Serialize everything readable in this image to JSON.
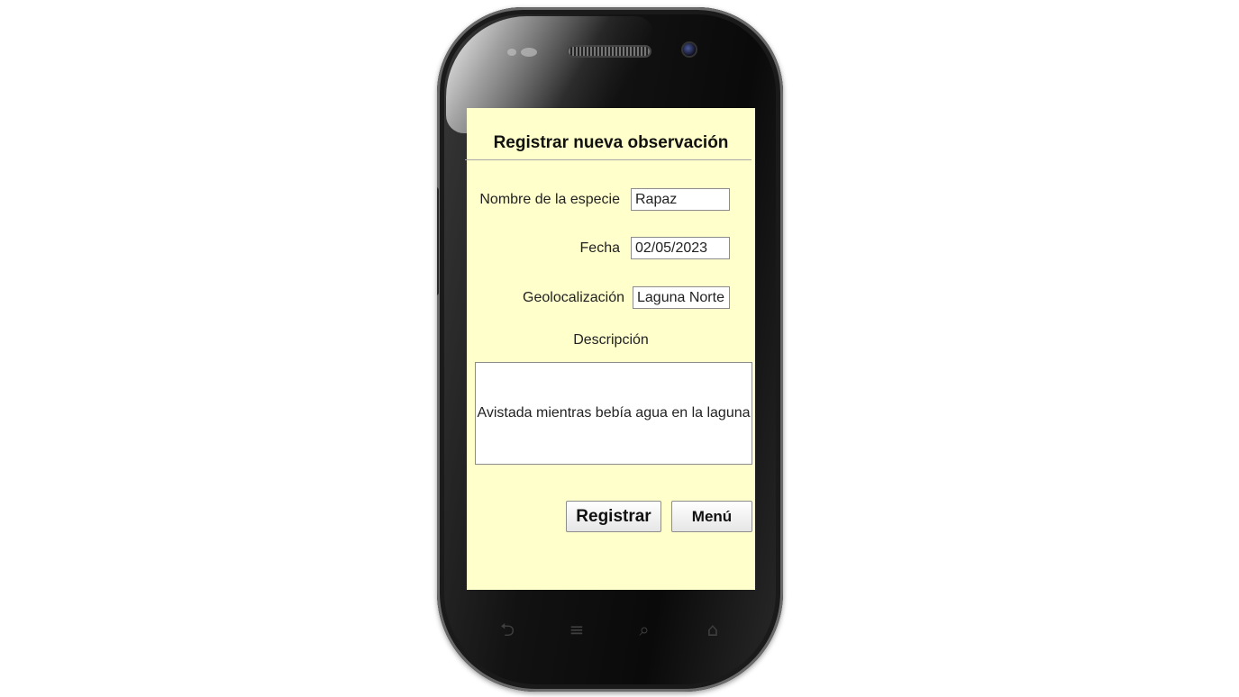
{
  "form": {
    "title": "Registrar nueva observación",
    "species_label": "Nombre de la especie",
    "species_value": "Rapaz",
    "date_label": "Fecha",
    "date_value": "02/05/2023",
    "geo_label": "Geolocalización",
    "geo_value": "Laguna Norte",
    "description_label": "Descripción",
    "description_value": "Avistada mientras bebía agua en la laguna"
  },
  "buttons": {
    "register_label": "Registrar",
    "menu_label": "Menú"
  },
  "nav_icons": [
    "back-icon",
    "menu-icon",
    "search-icon",
    "home-icon"
  ],
  "colors": {
    "screen_background": "#ffffcc",
    "phone_body": "#121212"
  }
}
